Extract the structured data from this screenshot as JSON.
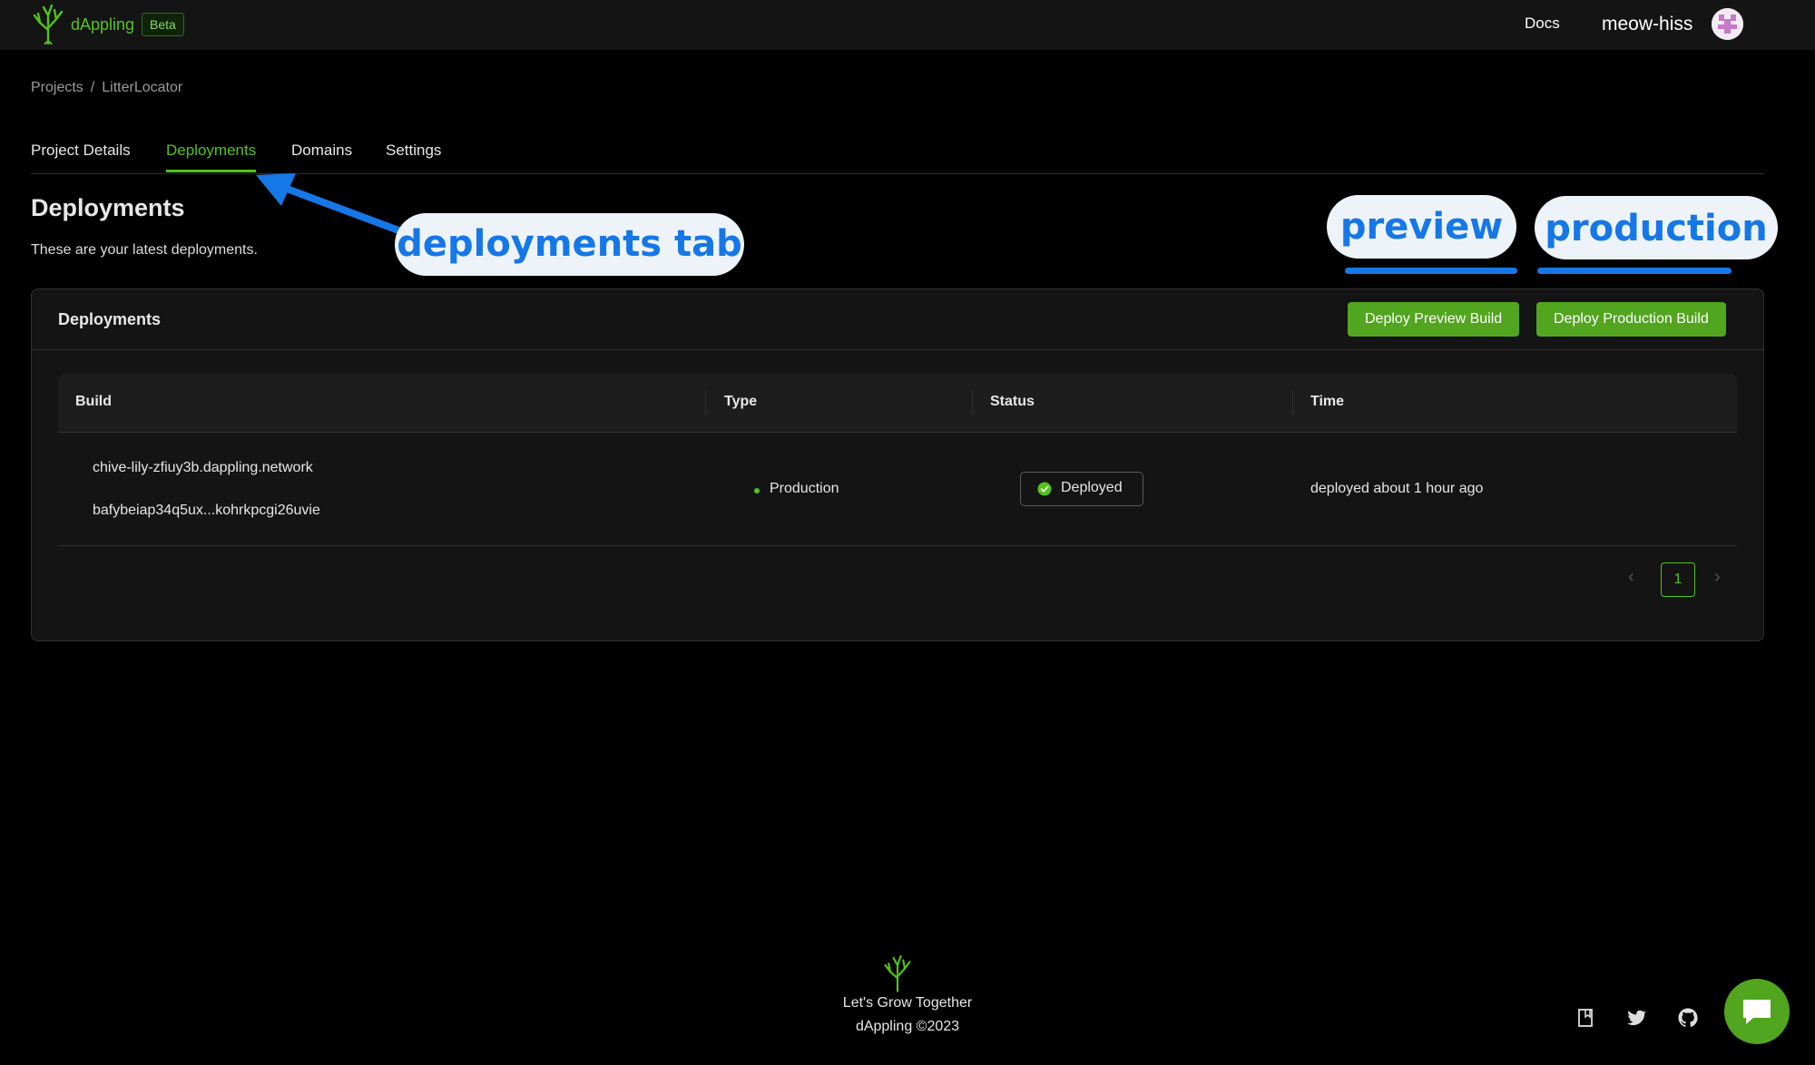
{
  "topbar": {
    "brand": "dAppling",
    "beta_label": "Beta",
    "docs_label": "Docs",
    "username": "meow-hiss"
  },
  "breadcrumb": {
    "items": [
      "Projects",
      "LitterLocator"
    ],
    "separator": "/"
  },
  "tabs": [
    {
      "label": "Project Details",
      "active": false
    },
    {
      "label": "Deployments",
      "active": true
    },
    {
      "label": "Domains",
      "active": false
    },
    {
      "label": "Settings",
      "active": false
    }
  ],
  "page": {
    "title": "Deployments",
    "subtitle": "These are your latest deployments."
  },
  "card": {
    "title": "Deployments",
    "deploy_preview_label": "Deploy Preview Build",
    "deploy_production_label": "Deploy Production Build"
  },
  "table": {
    "columns": [
      "Build",
      "Type",
      "Status",
      "Time"
    ],
    "rows": [
      {
        "build_url": "chive-lily-zfiuy3b.dappling.network",
        "build_cid": "bafybeiap34q5ux...kohrkpcgi26uvie",
        "type": "Production",
        "status": "Deployed",
        "time": "deployed about 1 hour ago"
      }
    ]
  },
  "pagination": {
    "current_page": "1",
    "prev_icon": "chevron-left-icon",
    "next_icon": "chevron-right-icon"
  },
  "annotations": {
    "deployments_tab": "deployments tab",
    "preview": "preview",
    "production": "production"
  },
  "footer": {
    "tagline": "Let's Grow Together",
    "copyright": "dAppling ©2023"
  },
  "colors": {
    "accent": "#52c41a",
    "button": "#52a51e",
    "annotation": "#1677e6",
    "background": "#000000",
    "topbar": "#141414"
  }
}
